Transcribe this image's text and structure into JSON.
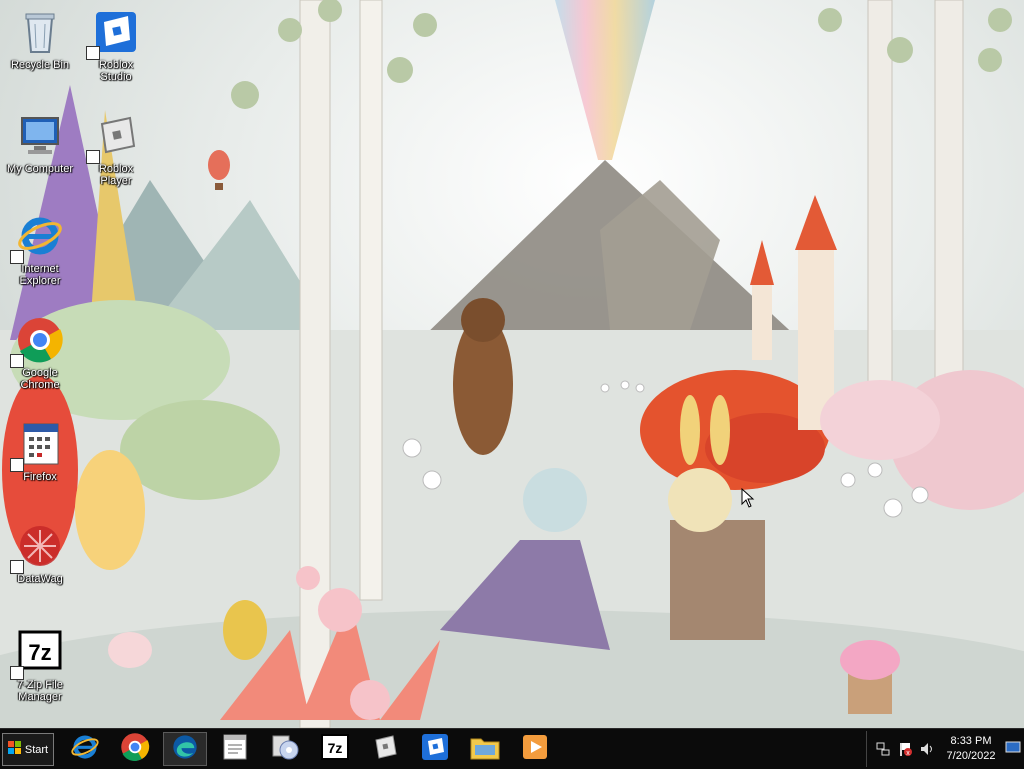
{
  "desktop": {
    "icons": [
      {
        "name": "recycle-bin-icon",
        "label": "Recycle Bin"
      },
      {
        "name": "roblox-studio-icon",
        "label": "Roblox\nStudio"
      },
      {
        "name": "my-computer-icon",
        "label": "My Computer"
      },
      {
        "name": "roblox-player-icon",
        "label": "Roblox\nPlayer"
      },
      {
        "name": "internet-explorer-icon",
        "label": "Internet\nExplorer"
      },
      {
        "name": "google-chrome-icon",
        "label": "Google\nChrome"
      },
      {
        "name": "firefox-icon",
        "label": "Firefox"
      },
      {
        "name": "datawag-icon",
        "label": "DataWag"
      },
      {
        "name": "7zip-icon",
        "label": "7-Zip File\nManager"
      }
    ]
  },
  "taskbar": {
    "start_label": "Start",
    "pinned": [
      "internet-explorer-icon",
      "chrome-icon",
      "edge-icon",
      "notepad-icon",
      "media-icon",
      "7zip-icon",
      "roblox-player-icon",
      "roblox-studio-icon",
      "file-explorer-icon",
      "media-player-icon"
    ],
    "clock": {
      "time": "8:33 PM",
      "date": "7/20/2022"
    }
  },
  "colors": {
    "taskbar": "#0b0b0b",
    "accent": "#1e6fd9"
  }
}
